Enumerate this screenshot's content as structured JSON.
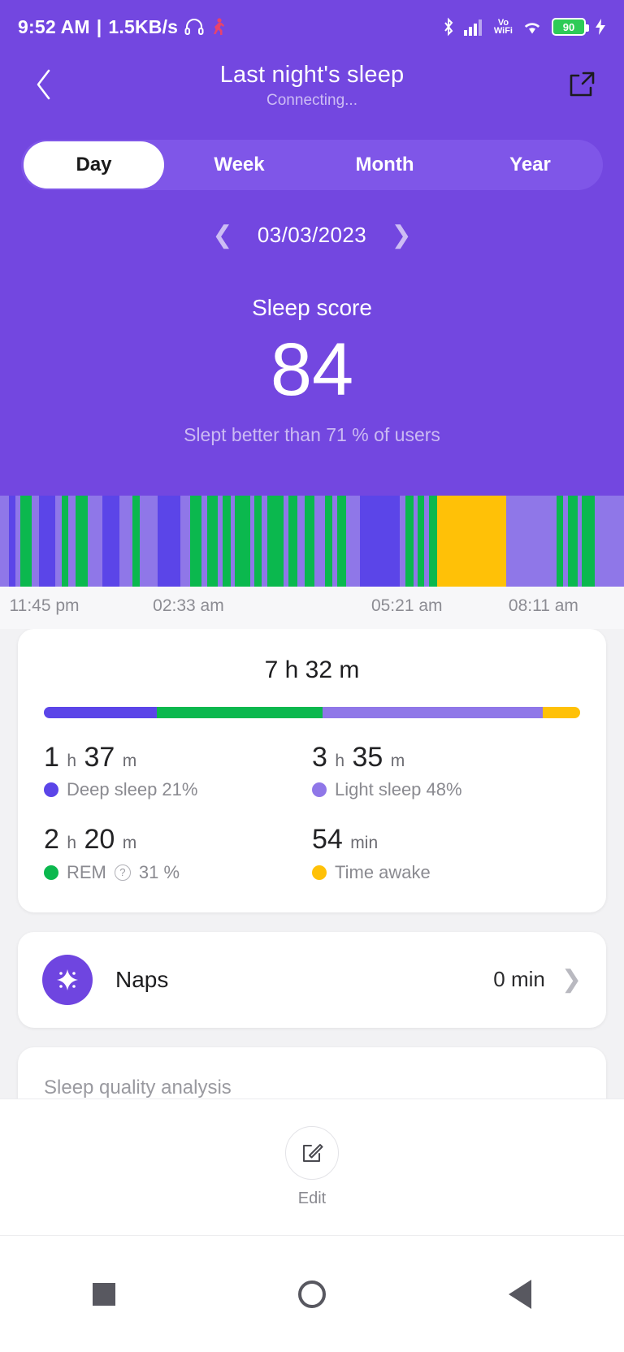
{
  "status_bar": {
    "time": "9:52 AM",
    "separator": "|",
    "network_speed": "1.5KB/s",
    "headphone_icon": "headphone-icon",
    "alarm_icon": "running-icon",
    "bluetooth_icon": "bluetooth-icon",
    "signal_icon": "cellular-signal-icon",
    "volte_line1": "Vo",
    "volte_line2": "WiFi",
    "wifi_icon": "wifi-icon",
    "battery_level": "90",
    "charging_icon": "charging-bolt-icon"
  },
  "header": {
    "back_icon": "chevron-left-icon",
    "title": "Last night's sleep",
    "subtitle": "Connecting...",
    "share_icon": "share-external-icon"
  },
  "tabs": {
    "items": [
      {
        "label": "Day",
        "active": true
      },
      {
        "label": "Week",
        "active": false
      },
      {
        "label": "Month",
        "active": false
      },
      {
        "label": "Year",
        "active": false
      }
    ]
  },
  "date_nav": {
    "prev_icon": "chevron-left-icon",
    "date": "03/03/2023",
    "next_icon": "chevron-right-icon"
  },
  "sleep_score": {
    "title": "Sleep score",
    "value": "84",
    "comparison": "Slept better than 71 % of users"
  },
  "colors": {
    "hero_purple": "#7347e0",
    "tab_track": "#7f56e8",
    "deep": "#5b45e8",
    "rem": "#0bb84e",
    "light": "#8f77e8",
    "awake": "#ffc107",
    "card_bg": "#ffffff",
    "page_bg": "#f2f2f4"
  },
  "chart_data": {
    "type": "bar",
    "title": "Sleep stages hypnogram",
    "xlabel": "",
    "ylabel": "",
    "grid": false,
    "legend_position": "below-card",
    "x_tick_labels": [
      "11:45 pm",
      "02:33 am",
      "05:21 am",
      "08:11 am"
    ],
    "x_tick_positions_pct": [
      1.5,
      24.5,
      59.5,
      81.5
    ],
    "axis_range": [
      "11:45 pm",
      "09:17 am"
    ],
    "stage_colors": {
      "deep": "#5b45e8",
      "rem": "#0bb84e",
      "light": "#8f77e8",
      "awake": "#ffc107"
    },
    "legend": [
      {
        "name": "Deep sleep",
        "color": "#5b45e8",
        "duration": "1 h 37 m",
        "percent": 21
      },
      {
        "name": "Light sleep",
        "color": "#8f77e8",
        "duration": "3 h 35 m",
        "percent": 48
      },
      {
        "name": "REM",
        "color": "#0bb84e",
        "duration": "2 h 20 m",
        "percent": 31
      },
      {
        "name": "Time awake",
        "color": "#ffc107",
        "duration": "54 min",
        "percent": 7
      }
    ],
    "segments": [
      {
        "stage": "light",
        "width": 1.3
      },
      {
        "stage": "deep",
        "width": 1.0
      },
      {
        "stage": "light",
        "width": 0.7
      },
      {
        "stage": "rem",
        "width": 1.6
      },
      {
        "stage": "light",
        "width": 1.1
      },
      {
        "stage": "deep",
        "width": 2.4
      },
      {
        "stage": "light",
        "width": 1.0
      },
      {
        "stage": "rem",
        "width": 0.9
      },
      {
        "stage": "light",
        "width": 1.1
      },
      {
        "stage": "rem",
        "width": 1.8
      },
      {
        "stage": "light",
        "width": 2.1
      },
      {
        "stage": "deep",
        "width": 2.6
      },
      {
        "stage": "light",
        "width": 1.9
      },
      {
        "stage": "rem",
        "width": 1.0
      },
      {
        "stage": "light",
        "width": 2.6
      },
      {
        "stage": "deep",
        "width": 3.4
      },
      {
        "stage": "light",
        "width": 1.4
      },
      {
        "stage": "rem",
        "width": 1.7
      },
      {
        "stage": "light",
        "width": 0.8
      },
      {
        "stage": "rem",
        "width": 1.6
      },
      {
        "stage": "light",
        "width": 0.7
      },
      {
        "stage": "rem",
        "width": 1.2
      },
      {
        "stage": "light",
        "width": 0.6
      },
      {
        "stage": "rem",
        "width": 2.2
      },
      {
        "stage": "light",
        "width": 0.6
      },
      {
        "stage": "rem",
        "width": 1.1
      },
      {
        "stage": "light",
        "width": 0.9
      },
      {
        "stage": "rem",
        "width": 2.4
      },
      {
        "stage": "light",
        "width": 0.7
      },
      {
        "stage": "rem",
        "width": 1.3
      },
      {
        "stage": "light",
        "width": 1.0
      },
      {
        "stage": "rem",
        "width": 1.5
      },
      {
        "stage": "light",
        "width": 1.6
      },
      {
        "stage": "rem",
        "width": 1.0
      },
      {
        "stage": "light",
        "width": 0.7
      },
      {
        "stage": "rem",
        "width": 1.4
      },
      {
        "stage": "light",
        "width": 2.0
      },
      {
        "stage": "deep",
        "width": 5.8
      },
      {
        "stage": "light",
        "width": 0.9
      },
      {
        "stage": "rem",
        "width": 1.1
      },
      {
        "stage": "light",
        "width": 0.6
      },
      {
        "stage": "rem",
        "width": 1.0
      },
      {
        "stage": "light",
        "width": 0.7
      },
      {
        "stage": "rem",
        "width": 1.2
      },
      {
        "stage": "awake",
        "width": 10.2
      },
      {
        "stage": "light",
        "width": 7.4
      },
      {
        "stage": "rem",
        "width": 0.9
      },
      {
        "stage": "light",
        "width": 0.7
      },
      {
        "stage": "rem",
        "width": 1.4
      },
      {
        "stage": "light",
        "width": 0.7
      },
      {
        "stage": "rem",
        "width": 1.9
      },
      {
        "stage": "light",
        "width": 4.2
      }
    ]
  },
  "duration_card": {
    "total": "7 h 32 m",
    "stack": [
      {
        "stage": "deep",
        "percent": 21,
        "color": "#5b45e8"
      },
      {
        "stage": "rem",
        "percent": 31,
        "color": "#0bb84e"
      },
      {
        "stage": "light",
        "percent": 41,
        "color": "#8f77e8"
      },
      {
        "stage": "awake",
        "percent": 7,
        "color": "#ffc107"
      }
    ],
    "stats": [
      {
        "value_number": "1",
        "value_unit1": "h",
        "value_number2": "37",
        "value_unit2": "m",
        "label": "Deep sleep 21%",
        "color": "#5b45e8",
        "has_help": false
      },
      {
        "value_number": "3",
        "value_unit1": "h",
        "value_number2": "35",
        "value_unit2": "m",
        "label": "Light sleep 48%",
        "color": "#8f77e8",
        "has_help": false
      },
      {
        "value_number": "2",
        "value_unit1": "h",
        "value_number2": "20",
        "value_unit2": "m",
        "label_before": "REM",
        "label_after": "31 %",
        "help_icon": "question-circle-icon",
        "color": "#0bb84e",
        "has_help": true
      },
      {
        "value_number": "54",
        "value_unit1": "min",
        "value_number2": "",
        "value_unit2": "",
        "label": "Time awake",
        "color": "#ffc107",
        "has_help": false
      }
    ]
  },
  "naps_card": {
    "icon": "sparkle-star-icon",
    "label": "Naps",
    "value": "0 min",
    "chevron_icon": "chevron-right-icon"
  },
  "analysis_card": {
    "title": "Sleep quality analysis"
  },
  "edit_bar": {
    "icon": "edit-pencil-icon",
    "label": "Edit"
  },
  "nav_bar": {
    "recents_icon": "recents-square-icon",
    "home_icon": "home-circle-icon",
    "back_icon": "back-triangle-icon"
  }
}
